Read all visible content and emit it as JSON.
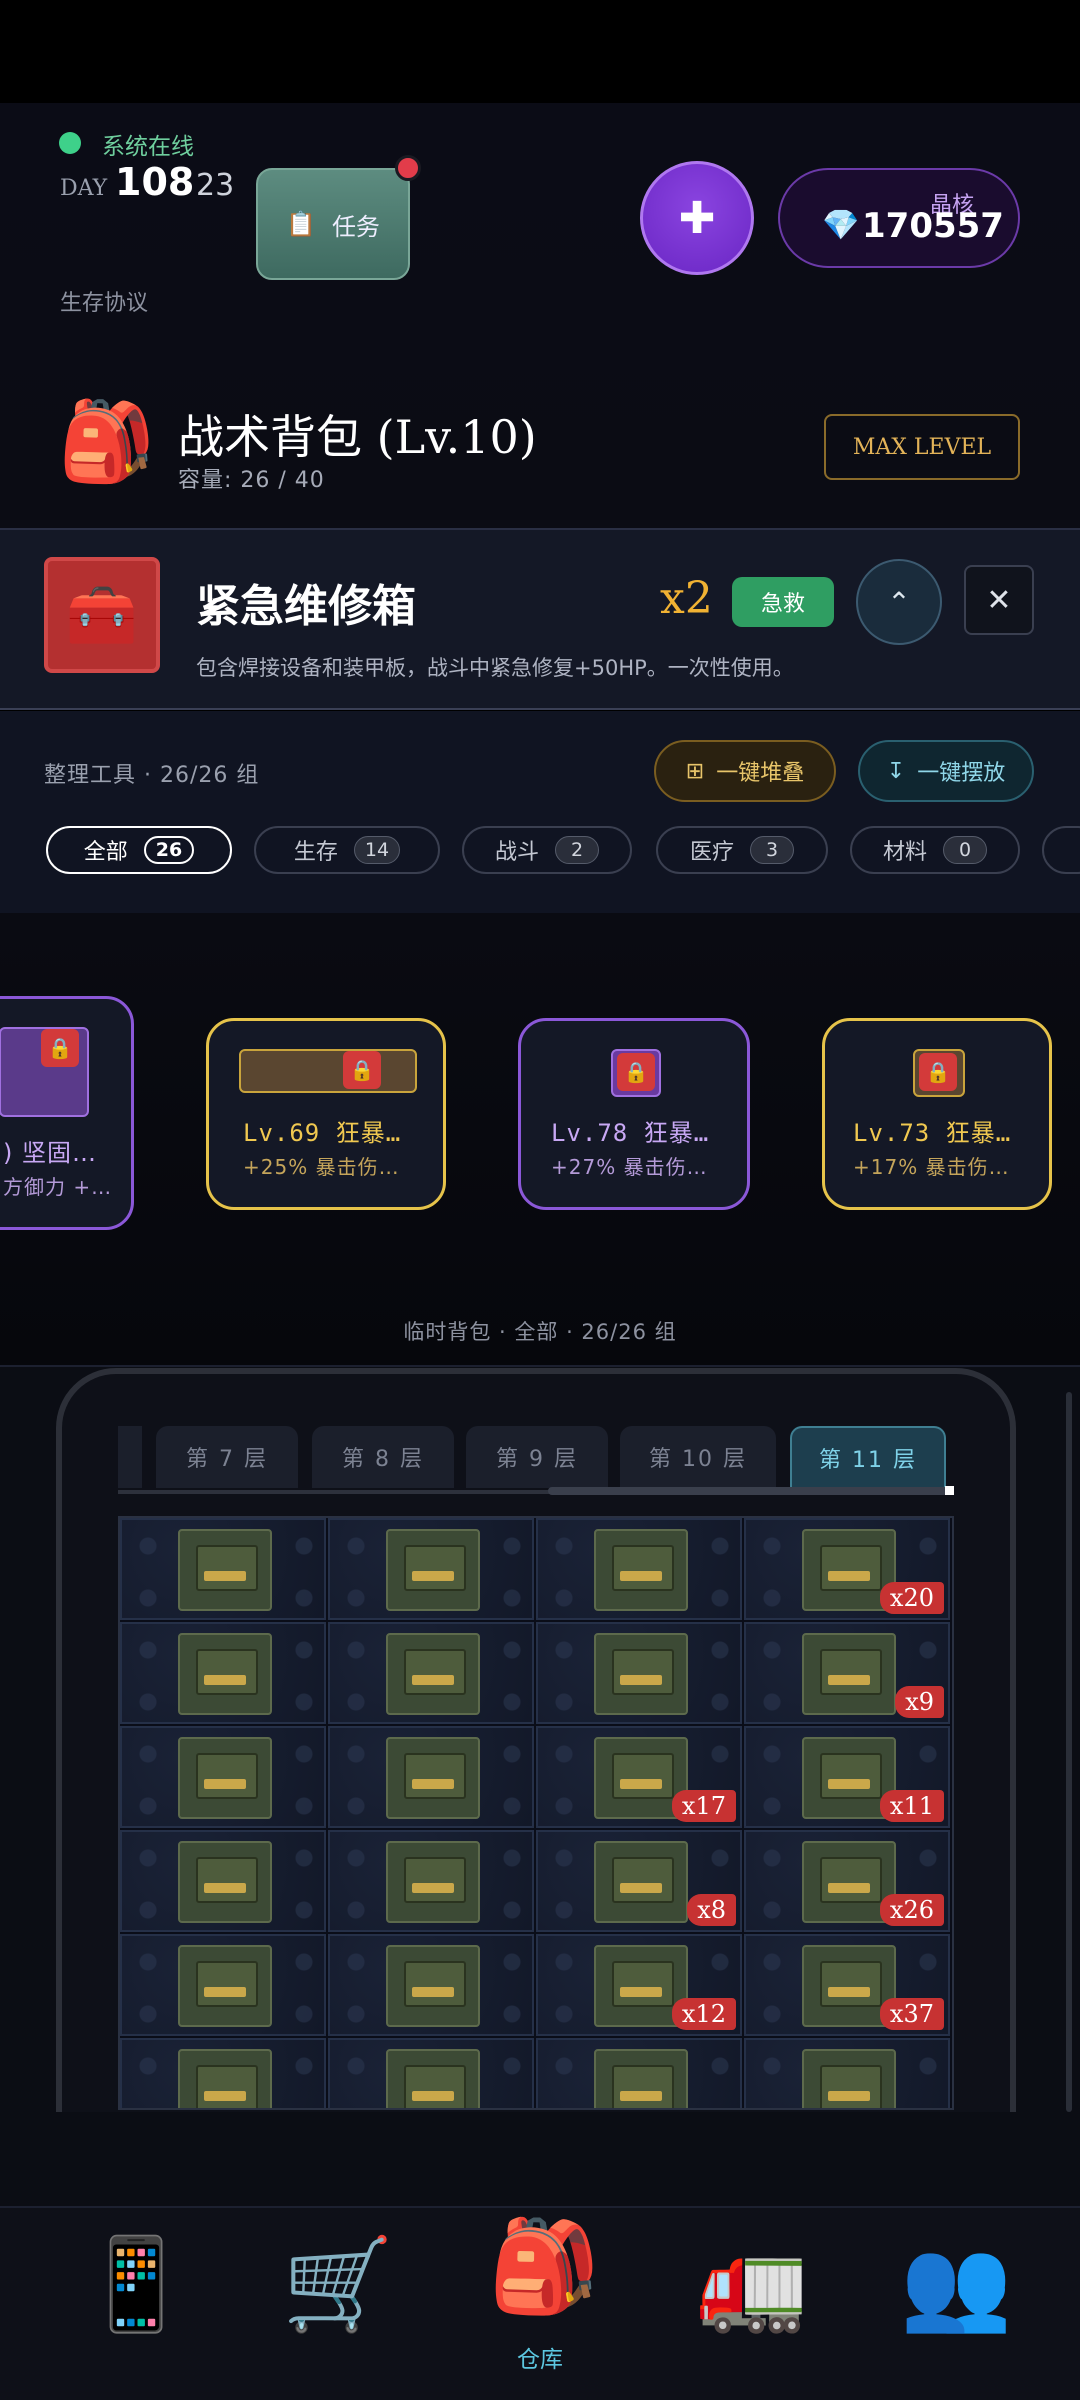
{
  "header": {
    "status": "系统在线",
    "day_label": "DAY",
    "day_number": "108",
    "day_sub": "23",
    "protocol": "生存协议",
    "task_icon": "📋",
    "task_label": "任务",
    "plus_label": "✚",
    "crystal_label": "晶核",
    "crystal_icon": "💎",
    "crystal_value": "170557"
  },
  "bag": {
    "icon": "🎒",
    "title": "战术背包 (Lv.10)",
    "capacity": "容量: 26 / 40",
    "max_level": "MAX LEVEL"
  },
  "detail": {
    "icon": "🧰",
    "name": "紧急维修箱",
    "qty": "x2",
    "tag": "急救",
    "collapse_icon": "⌃",
    "close_icon": "✕",
    "desc": "包含焊接设备和装甲板，战斗中紧急修复+50HP。一次性使用。"
  },
  "tools": {
    "label": "整理工具 · 26/26 组",
    "stack_icon": "⊞",
    "stack_label": "一键堆叠",
    "arrange_icon": "↧",
    "arrange_label": "一键摆放",
    "filters": [
      {
        "label": "全部",
        "count": "26"
      },
      {
        "label": "生存",
        "count": "14"
      },
      {
        "label": "战斗",
        "count": "2"
      },
      {
        "label": "医疗",
        "count": "3"
      },
      {
        "label": "材料",
        "count": "0"
      }
    ]
  },
  "cards": [
    {
      "title": ") 坚固…",
      "sub": "方御力 +…"
    },
    {
      "title": "Lv.69 狂暴…",
      "sub": "+25% 暴击伤…"
    },
    {
      "title": "Lv.78 狂暴…",
      "sub": "+27% 暴击伤…"
    },
    {
      "title": "Lv.73 狂暴…",
      "sub": "+17% 暴击伤…"
    }
  ],
  "lock_icon": "🔒",
  "temp_label": "临时背包 · 全部 · 26/26 组",
  "layers": [
    "第 7 层",
    "第 8 层",
    "第 9 层",
    "第 10 层",
    "第 11 层"
  ],
  "grid_badges": [
    [
      "",
      "",
      "",
      "x20"
    ],
    [
      "",
      "",
      "",
      "x9"
    ],
    [
      "",
      "",
      "x17",
      "x11"
    ],
    [
      "",
      "",
      "x8",
      "x26"
    ],
    [
      "",
      "",
      "x12",
      "x37"
    ],
    [
      "",
      "",
      "",
      ""
    ]
  ],
  "nav": {
    "items": [
      "📱",
      "🛒",
      "🎒",
      "🚛",
      "👥"
    ],
    "active_label": "仓库"
  },
  "colors": {
    "accent_purple": "#6a26c4",
    "accent_gold": "#f1b233",
    "accent_cyan": "#5cc7e0",
    "badge_red": "#c73232",
    "status_green": "#3ed18a"
  }
}
